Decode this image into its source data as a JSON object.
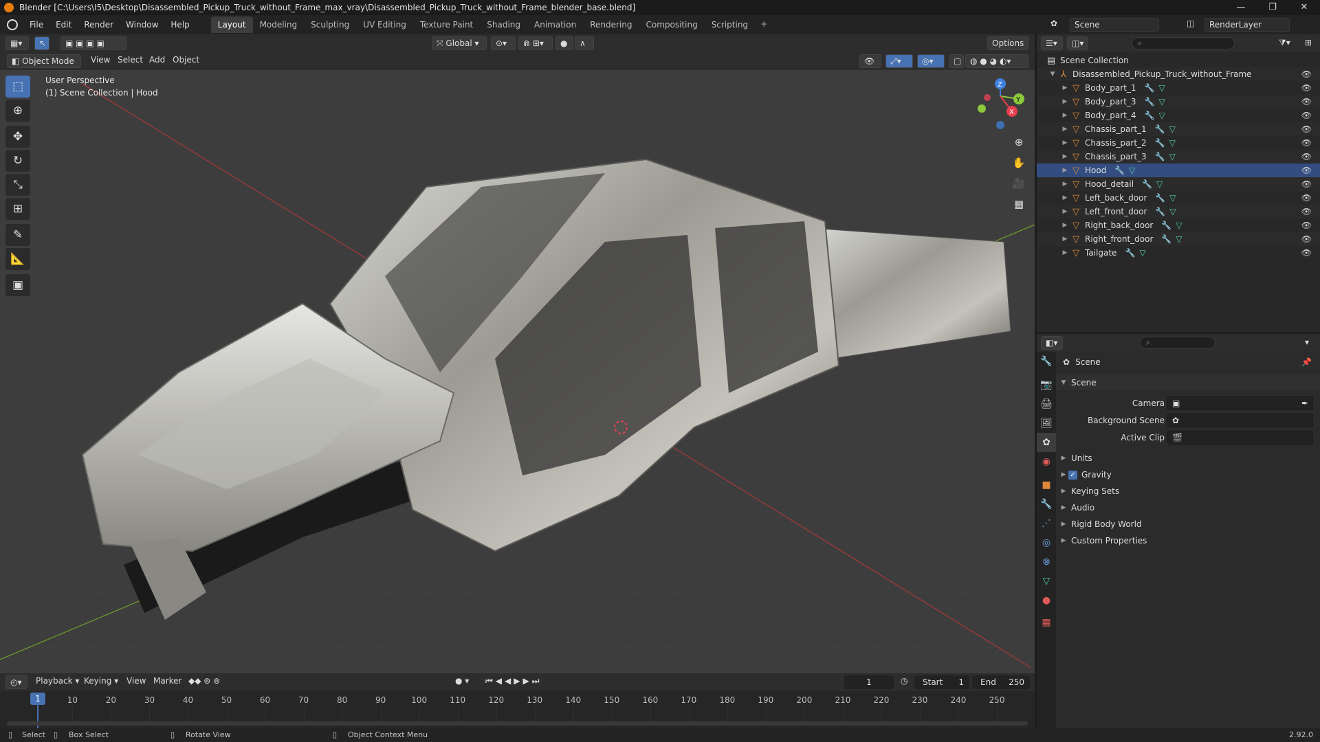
{
  "window": {
    "title": "Blender [C:\\Users\\I5\\Desktop\\Disassembled_Pickup_Truck_without_Frame_max_vray\\Disassembled_Pickup_Truck_without_Frame_blender_base.blend]",
    "minimize": "—",
    "maximize": "❐",
    "close": "✕"
  },
  "menubar": {
    "items": [
      "File",
      "Edit",
      "Render",
      "Window",
      "Help"
    ],
    "workspaces": [
      "Layout",
      "Modeling",
      "Sculpting",
      "UV Editing",
      "Texture Paint",
      "Shading",
      "Animation",
      "Rendering",
      "Compositing",
      "Scripting"
    ],
    "active_workspace": "Layout",
    "add_tab": "+",
    "scene": "Scene",
    "view_layer": "RenderLayer"
  },
  "viewport_header": {
    "transform_orientation": "Global",
    "options": "Options",
    "mode": "Object Mode",
    "menus": [
      "View",
      "Select",
      "Add",
      "Object"
    ]
  },
  "viewport": {
    "perspective_label": "User Perspective",
    "collection_label": "(1) Scene Collection | Hood",
    "gizmo": {
      "x": "X",
      "y": "Y",
      "z": "Z"
    }
  },
  "toolbar": {
    "tools": [
      "select-box",
      "cursor",
      "move",
      "rotate",
      "scale",
      "transform",
      "annotate",
      "measure",
      "add-cube"
    ]
  },
  "outliner": {
    "root": "Scene Collection",
    "collection": "Disassembled_Pickup_Truck_without_Frame",
    "objects": [
      "Body_part_1",
      "Body_part_3",
      "Body_part_4",
      "Chassis_part_1",
      "Chassis_part_2",
      "Chassis_part_3",
      "Hood",
      "Hood_detail",
      "Left_back_door",
      "Left_front_door",
      "Right_back_door",
      "Right_front_door",
      "Tailgate"
    ],
    "active_object": "Hood"
  },
  "properties": {
    "context": "Scene",
    "panel": "Scene",
    "fields": [
      {
        "label": "Camera",
        "value": ""
      },
      {
        "label": "Background Scene",
        "value": ""
      },
      {
        "label": "Active Clip",
        "value": ""
      }
    ],
    "subpanels": [
      "Units",
      "Gravity",
      "Keying Sets",
      "Audio",
      "Rigid Body World",
      "Custom Properties"
    ],
    "gravity_checked": true
  },
  "timeline": {
    "menus": [
      "Playback",
      "Keying",
      "View",
      "Marker"
    ],
    "current_frame": "1",
    "start_label": "Start",
    "start": "1",
    "end_label": "End",
    "end": "250",
    "ticks": [
      "10",
      "20",
      "30",
      "40",
      "50",
      "60",
      "70",
      "80",
      "90",
      "100",
      "110",
      "120",
      "130",
      "140",
      "150",
      "160",
      "170",
      "180",
      "190",
      "200",
      "210",
      "220",
      "230",
      "240",
      "250"
    ],
    "playhead": "1"
  },
  "statusbar": {
    "select": "Select",
    "box_select": "Box Select",
    "rotate_view": "Rotate View",
    "context_menu": "Object Context Menu",
    "version": "2.92.0"
  },
  "colors": {
    "accent": "#4772b3",
    "object_orange": "#e0883a",
    "mesh_green": "#4fd1a6",
    "axis_x": "#e8404f",
    "axis_y": "#8bc93b",
    "axis_z": "#3f7fe0"
  }
}
